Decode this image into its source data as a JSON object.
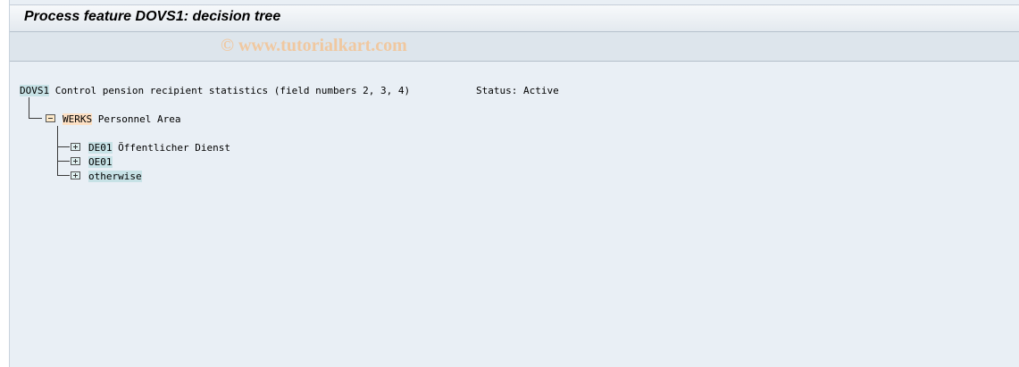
{
  "window": {
    "title": "Process feature DOVS1: decision tree",
    "watermark": "© www.tutorialkart.com"
  },
  "tree": {
    "root": {
      "key": "DOVS1",
      "text": " Control pension recipient statistics (field numbers 2, 3, 4)",
      "status": "Status: Active"
    },
    "node": {
      "key": "WERKS",
      "text": " Personnel Area"
    },
    "leaves": [
      {
        "key": "DE01",
        "text": " Öffentlicher Dienst"
      },
      {
        "key": "OE01",
        "text": ""
      },
      {
        "key": "otherwise",
        "text": ""
      }
    ]
  },
  "colors": {
    "background": "#e9eff5",
    "key_highlight": "#c7e2e6",
    "node_highlight": "#fde0c4"
  },
  "icons": {
    "node": "collapse-folder-icon",
    "leaf": "expand-folder-icon"
  }
}
